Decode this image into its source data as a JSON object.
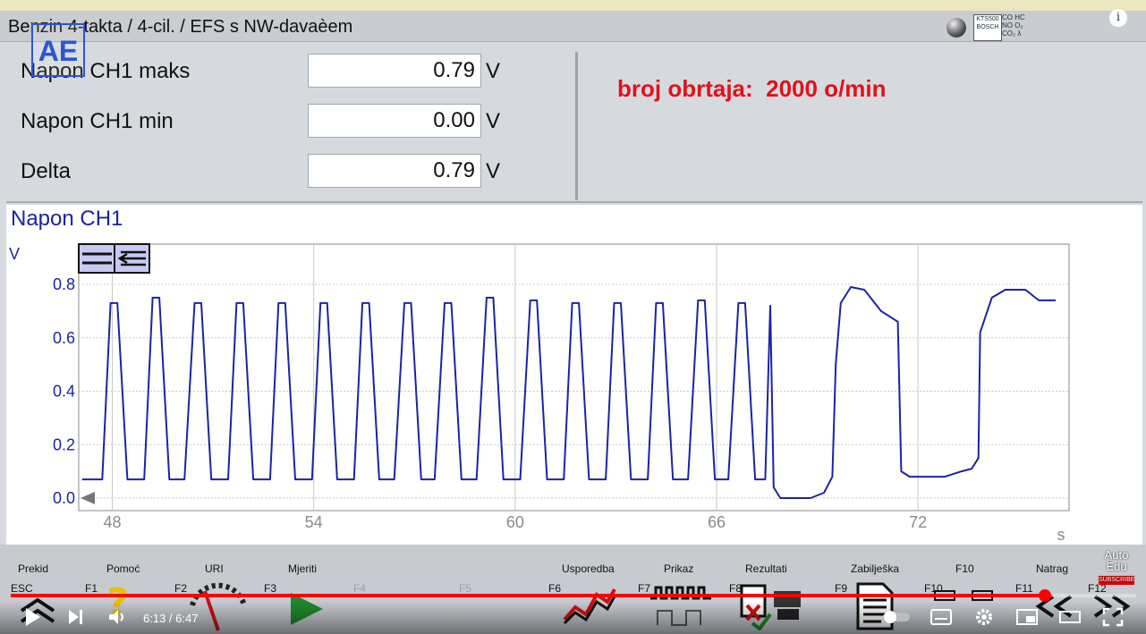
{
  "header": {
    "title": "Benzin 4-takta /  4-cil. / EFS s NW-davaèem",
    "kts_label": "KTS500 BOSCH",
    "gas_label": "CO HC NO O₂ CO₂ λ"
  },
  "logo": "AE",
  "measurements": [
    {
      "label": "Napon CH1 maks",
      "value": "0.79",
      "unit": "V"
    },
    {
      "label": "Napon CH1 min",
      "value": "0.00",
      "unit": "V"
    },
    {
      "label": "Delta",
      "value": "0.79",
      "unit": "V"
    }
  ],
  "rpm_text": "broj obrtaja:  2000 o/min",
  "chart_title": "Napon CH1",
  "chart_data": {
    "type": "line",
    "title": "Napon CH1",
    "xlabel": "s",
    "ylabel": "V",
    "xlim": [
      47,
      76.5
    ],
    "ylim": [
      0,
      0.9
    ],
    "x_ticks": [
      "48",
      "54",
      "60",
      "66",
      "72"
    ],
    "y_ticks": [
      "0.0",
      "0.2",
      "0.4",
      "0.6",
      "0.8"
    ],
    "grid": true,
    "series": [
      {
        "color": "#1c23a4",
        "points": [
          [
            47.1,
            0.07
          ],
          [
            47.7,
            0.07
          ],
          [
            47.95,
            0.73
          ],
          [
            48.15,
            0.73
          ],
          [
            48.45,
            0.07
          ],
          [
            48.95,
            0.07
          ],
          [
            49.2,
            0.75
          ],
          [
            49.4,
            0.75
          ],
          [
            49.7,
            0.07
          ],
          [
            50.15,
            0.07
          ],
          [
            50.45,
            0.73
          ],
          [
            50.65,
            0.73
          ],
          [
            50.95,
            0.07
          ],
          [
            51.45,
            0.07
          ],
          [
            51.7,
            0.73
          ],
          [
            51.9,
            0.73
          ],
          [
            52.2,
            0.07
          ],
          [
            52.7,
            0.07
          ],
          [
            52.95,
            0.73
          ],
          [
            53.15,
            0.73
          ],
          [
            53.45,
            0.07
          ],
          [
            53.95,
            0.07
          ],
          [
            54.2,
            0.73
          ],
          [
            54.4,
            0.73
          ],
          [
            54.7,
            0.07
          ],
          [
            55.2,
            0.07
          ],
          [
            55.45,
            0.73
          ],
          [
            55.65,
            0.73
          ],
          [
            55.95,
            0.07
          ],
          [
            56.4,
            0.07
          ],
          [
            56.7,
            0.73
          ],
          [
            56.9,
            0.73
          ],
          [
            57.2,
            0.07
          ],
          [
            57.6,
            0.07
          ],
          [
            57.9,
            0.73
          ],
          [
            58.1,
            0.73
          ],
          [
            58.4,
            0.07
          ],
          [
            58.85,
            0.07
          ],
          [
            59.15,
            0.75
          ],
          [
            59.35,
            0.75
          ],
          [
            59.65,
            0.07
          ],
          [
            60.15,
            0.07
          ],
          [
            60.45,
            0.74
          ],
          [
            60.65,
            0.74
          ],
          [
            60.95,
            0.07
          ],
          [
            61.45,
            0.07
          ],
          [
            61.7,
            0.73
          ],
          [
            61.9,
            0.73
          ],
          [
            62.2,
            0.07
          ],
          [
            62.7,
            0.07
          ],
          [
            62.95,
            0.73
          ],
          [
            63.15,
            0.73
          ],
          [
            63.45,
            0.07
          ],
          [
            63.95,
            0.07
          ],
          [
            64.2,
            0.73
          ],
          [
            64.4,
            0.73
          ],
          [
            64.7,
            0.07
          ],
          [
            65.15,
            0.07
          ],
          [
            65.45,
            0.74
          ],
          [
            65.65,
            0.74
          ],
          [
            65.95,
            0.07
          ],
          [
            66.35,
            0.07
          ],
          [
            66.65,
            0.73
          ],
          [
            66.85,
            0.73
          ],
          [
            67.15,
            0.07
          ],
          [
            67.45,
            0.07
          ],
          [
            67.6,
            0.72
          ],
          [
            67.7,
            0.04
          ],
          [
            67.9,
            0.0
          ],
          [
            68.8,
            0.0
          ],
          [
            69.2,
            0.02
          ],
          [
            69.45,
            0.08
          ],
          [
            69.55,
            0.5
          ],
          [
            69.7,
            0.73
          ],
          [
            70.0,
            0.79
          ],
          [
            70.4,
            0.78
          ],
          [
            70.9,
            0.7
          ],
          [
            71.4,
            0.66
          ],
          [
            71.5,
            0.1
          ],
          [
            71.75,
            0.08
          ],
          [
            72.8,
            0.08
          ],
          [
            73.3,
            0.1
          ],
          [
            73.6,
            0.11
          ],
          [
            73.8,
            0.15
          ],
          [
            73.85,
            0.62
          ],
          [
            74.2,
            0.75
          ],
          [
            74.6,
            0.78
          ],
          [
            75.2,
            0.78
          ],
          [
            75.6,
            0.74
          ],
          [
            76.1,
            0.74
          ]
        ]
      }
    ]
  },
  "chart_controls": {
    "scroll_icon": "scroll-arrow-icon"
  },
  "fkeys": [
    {
      "code": "ESC",
      "label": "Prekid",
      "icon": "double-up-chevron-icon",
      "enabled": true
    },
    {
      "code": "F1",
      "label": "Pomoć",
      "icon": "help-question-icon",
      "enabled": true
    },
    {
      "code": "F2",
      "label": "URI",
      "icon": "gauge-icon",
      "enabled": true
    },
    {
      "code": "F3",
      "label": "Mjeriti",
      "icon": "play-icon",
      "enabled": true
    },
    {
      "code": "F4",
      "label": "",
      "icon": "",
      "enabled": false
    },
    {
      "code": "F5",
      "label": "",
      "icon": "",
      "enabled": false
    },
    {
      "code": "F6",
      "label": "Usporedba",
      "icon": "compare-wave-icon",
      "enabled": true
    },
    {
      "code": "F7",
      "label": "Prikaz",
      "icon": "square-wave-icon",
      "enabled": true
    },
    {
      "code": "F8",
      "label": "Rezultati",
      "icon": "results-print-icon",
      "enabled": true
    },
    {
      "code": "F9",
      "label": "Zabilješka",
      "icon": "note-document-icon",
      "enabled": true
    },
    {
      "code": "F10",
      "label": "F10",
      "icon": "f10-connector-icon",
      "enabled": true
    },
    {
      "code": "F11",
      "label": "Natrag",
      "icon": "back-arrows-icon",
      "enabled": true
    },
    {
      "code": "F12",
      "label": "",
      "icon": "forward-arrows-icon",
      "enabled": true
    }
  ],
  "player": {
    "time": "6:13 / 6:47",
    "progress": 0.919
  },
  "watermark": {
    "text": "Auto Edu",
    "subscribe": "SUBSCRIBE"
  }
}
